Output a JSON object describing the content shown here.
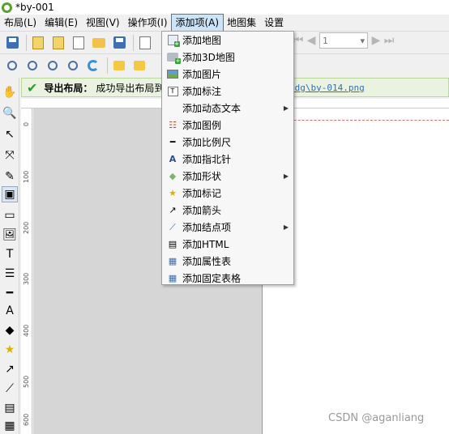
{
  "window": {
    "title": "*by-001"
  },
  "menubar": {
    "items": [
      {
        "label": "布局(L)"
      },
      {
        "label": "编辑(E)"
      },
      {
        "label": "视图(V)"
      },
      {
        "label": "操作项(I)"
      },
      {
        "label": "添加项(A)"
      },
      {
        "label": "地图集"
      },
      {
        "label": "设置"
      }
    ]
  },
  "navigation": {
    "page_value": "1"
  },
  "message_bar": {
    "title": "导出布局：",
    "text": "成功导出布局到",
    "path": "-dg\\by-014.png"
  },
  "ruler": {
    "left_labels": [
      "0",
      "100",
      "200",
      "300",
      "400",
      "500",
      "600"
    ]
  },
  "add_menu": {
    "items": [
      {
        "label": "添加地图",
        "icon": "add-map-icon",
        "submenu": false
      },
      {
        "label": "添加3D地图",
        "icon": "add-3d-map-icon",
        "submenu": false
      },
      {
        "label": "添加图片",
        "icon": "add-picture-icon",
        "submenu": false
      },
      {
        "label": "添加标注",
        "icon": "add-label-icon",
        "submenu": false
      },
      {
        "label": "添加动态文本",
        "icon": "",
        "submenu": true
      },
      {
        "label": "添加图例",
        "icon": "add-legend-icon",
        "submenu": false
      },
      {
        "label": "添加比例尺",
        "icon": "add-scalebar-icon",
        "submenu": false
      },
      {
        "label": "添加指北针",
        "icon": "add-north-arrow-icon",
        "submenu": false
      },
      {
        "label": "添加形状",
        "icon": "add-shape-icon",
        "submenu": true
      },
      {
        "label": "添加标记",
        "icon": "add-marker-icon",
        "submenu": false
      },
      {
        "label": "添加箭头",
        "icon": "add-arrow-icon",
        "submenu": false
      },
      {
        "label": "添加结点项",
        "icon": "add-node-item-icon",
        "submenu": true
      },
      {
        "label": "添加HTML",
        "icon": "add-html-icon",
        "submenu": false
      },
      {
        "label": "添加属性表",
        "icon": "add-attribute-table-icon",
        "submenu": false
      },
      {
        "label": "添加固定表格",
        "icon": "add-fixed-table-icon",
        "submenu": false
      }
    ]
  },
  "watermark": "CSDN @aganliang"
}
